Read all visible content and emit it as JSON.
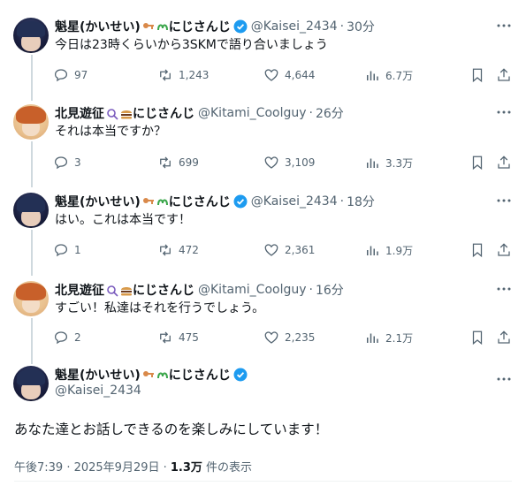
{
  "colors": {
    "accent": "#1d9bf0",
    "text": "#0f1419",
    "muted": "#536471",
    "thread_line": "#cfd9de"
  },
  "tweets": [
    {
      "name": "魁星(かいせい)",
      "suffix": "にじさんじ",
      "handle": "@Kaisei_2434",
      "sep": "·",
      "time": "30分",
      "text": "今日は23時くらいから3SKMで語り合いましょう",
      "replies": "97",
      "retweets": "1,243",
      "likes": "4,644",
      "views": "6.7万"
    },
    {
      "name": "北見遊征",
      "suffix": "にじさんじ",
      "handle": "@Kitami_Coolguy",
      "sep": "·",
      "time": "26分",
      "text": "それは本当ですか？",
      "replies": "3",
      "retweets": "699",
      "likes": "3,109",
      "views": "3.3万"
    },
    {
      "name": "魁星(かいせい)",
      "suffix": "にじさんじ",
      "handle": "@Kaisei_2434",
      "sep": "·",
      "time": "18分",
      "text": "はい。これは本当です！",
      "replies": "1",
      "retweets": "472",
      "likes": "2,361",
      "views": "1.9万"
    },
    {
      "name": "北見遊征",
      "suffix": "にじさんじ",
      "handle": "@Kitami_Coolguy",
      "sep": "·",
      "time": "16分",
      "text": "すごい！私達はそれを行うでしょう。",
      "replies": "2",
      "retweets": "475",
      "likes": "2,235",
      "views": "2.1万"
    }
  ],
  "main_tweet": {
    "name": "魁星(かいせい)",
    "suffix": "にじさんじ",
    "handle": "@Kaisei_2434",
    "text": "あなた達とお話しできるのを楽しみにしています！",
    "timestamp": "午後7:39 · 2025年9月29日 · ",
    "views": "1.3万",
    "views_suffix": " 件の表示"
  }
}
